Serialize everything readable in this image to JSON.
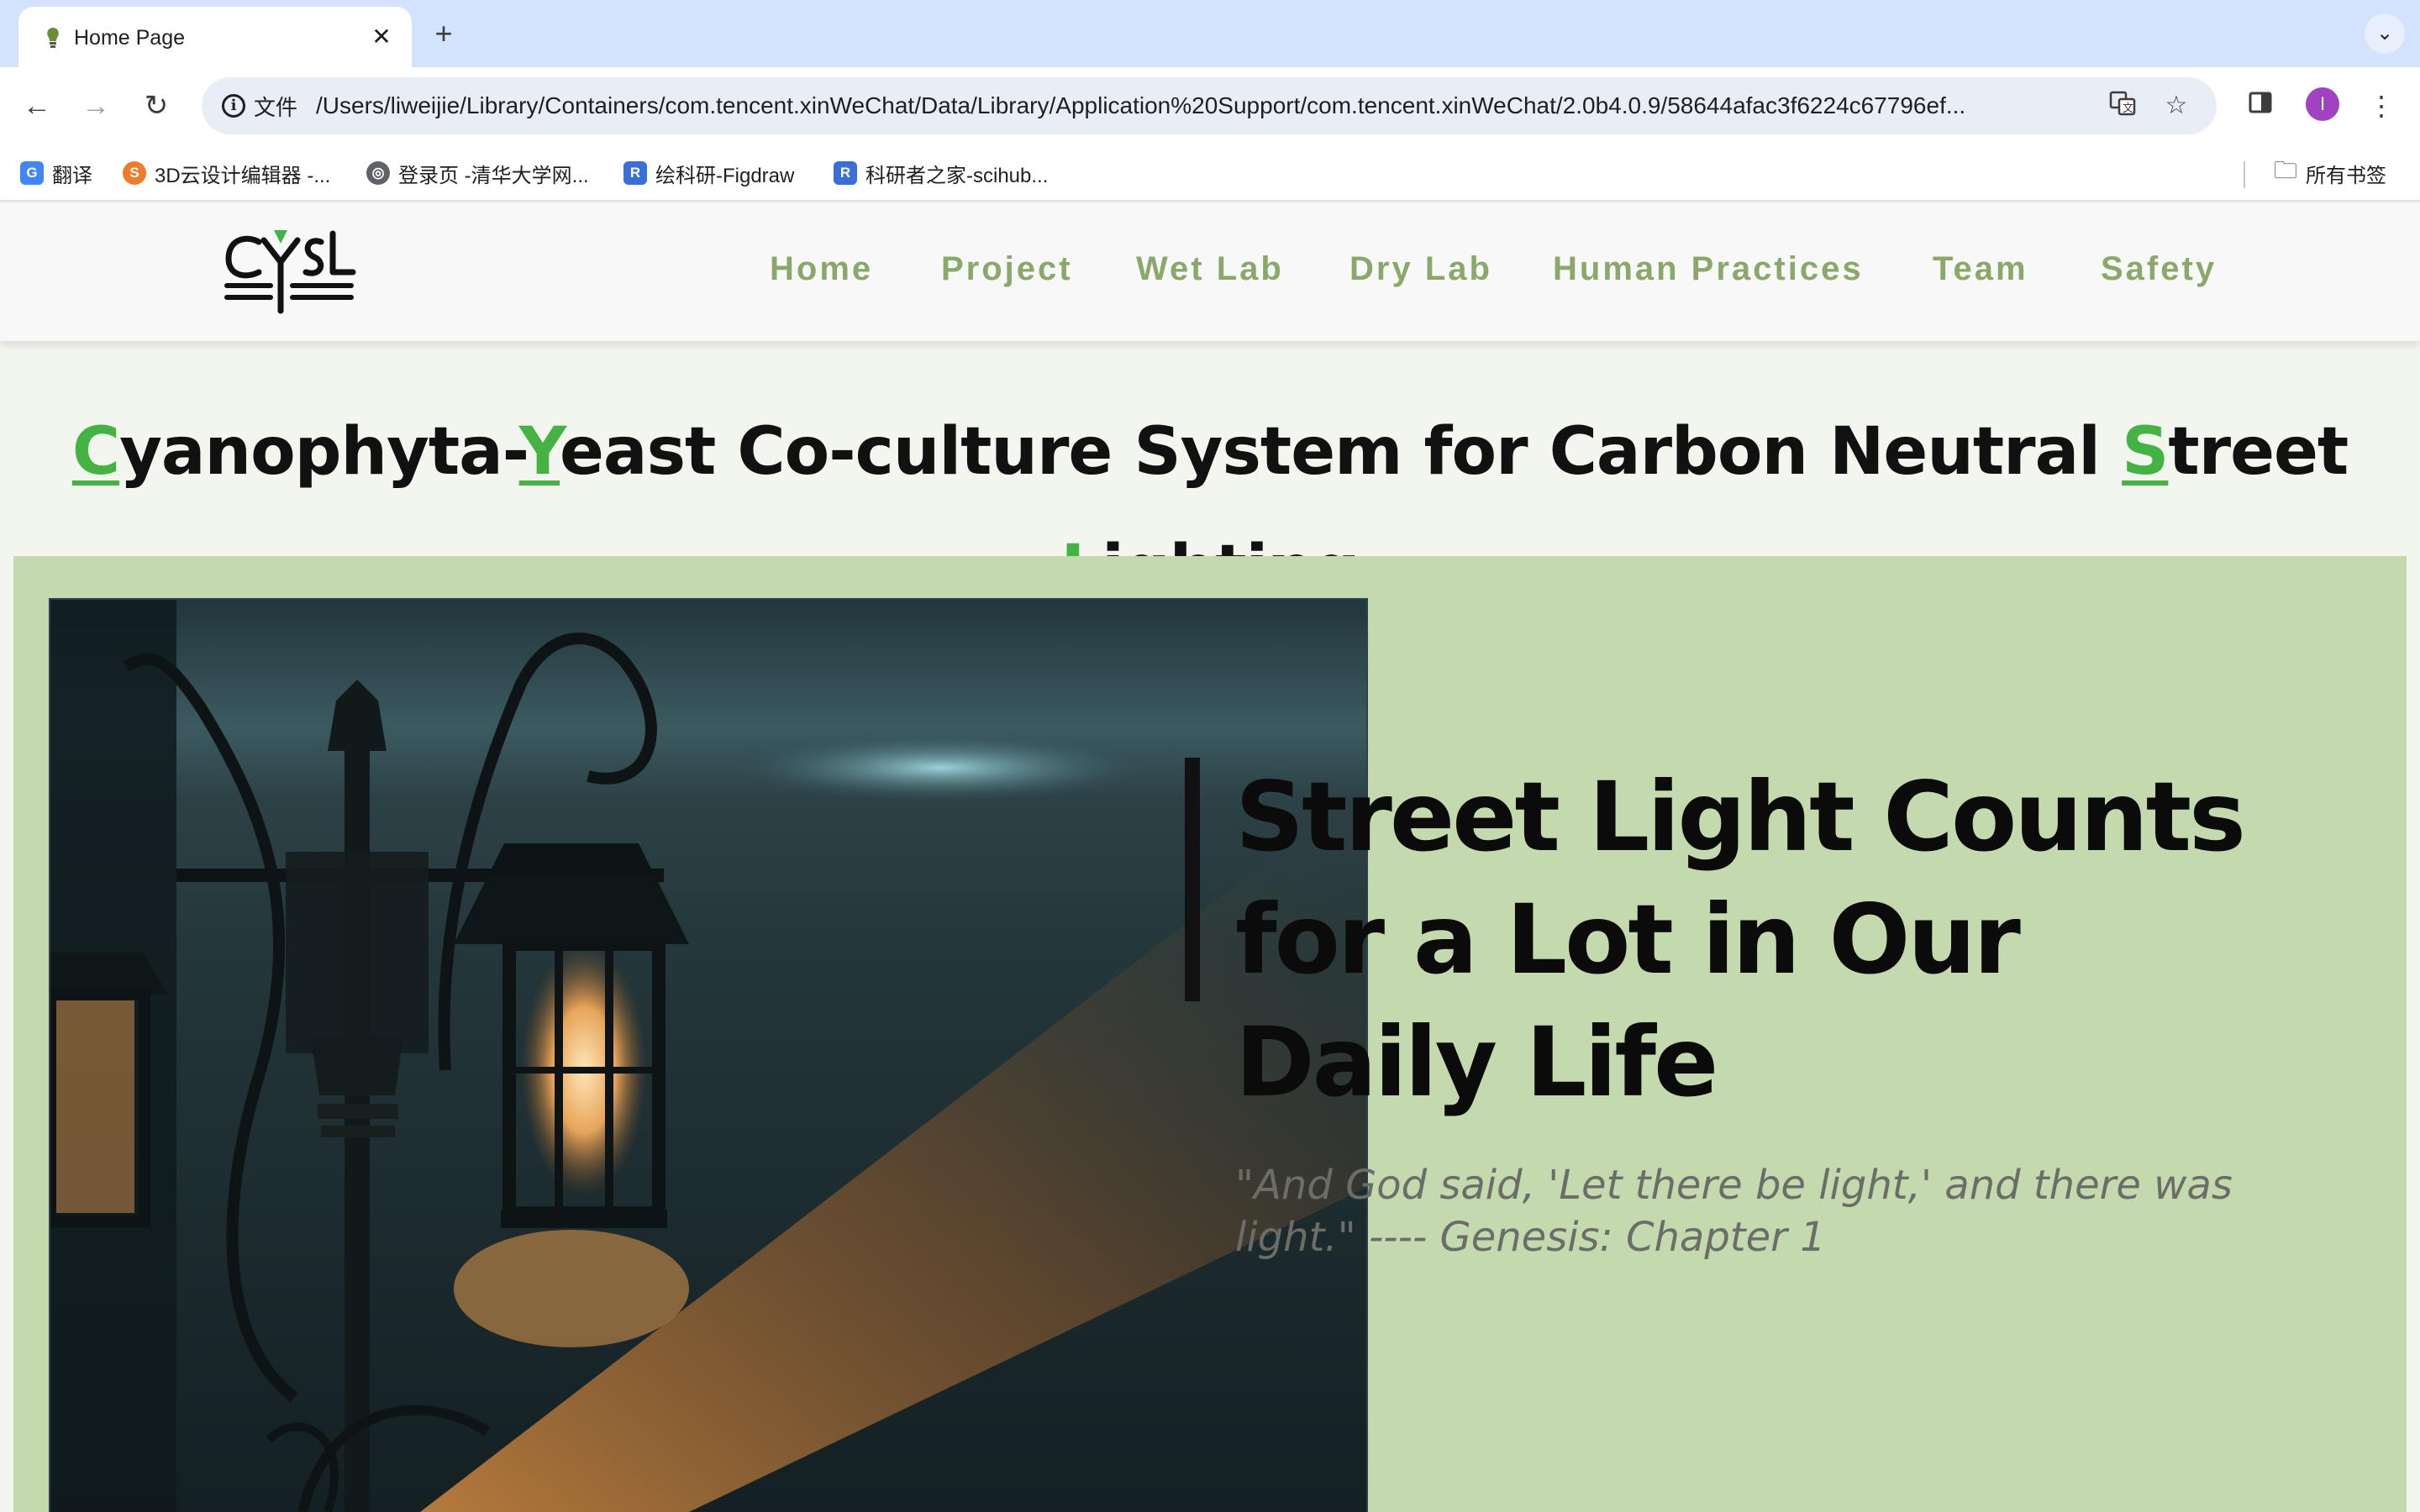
{
  "browser": {
    "tab": {
      "title": "Home Page"
    },
    "new_tab_symbol": "+",
    "address": {
      "security_label": "文件",
      "url": "/Users/liweijie/Library/Containers/com.tencent.xinWeChat/Data/Library/Application%20Support/com.tencent.xinWeChat/2.0b4.0.9/58644afac3f6224c67796ef..."
    },
    "profile_initial": "I",
    "bookmarks": [
      {
        "label": "翻译",
        "icon": "google-translate-icon",
        "color": "#4285f4"
      },
      {
        "label": "3D云设计编辑器 -...",
        "icon": "3d-editor-icon",
        "color": "#f07c2b"
      },
      {
        "label": "登录页 -清华大学网...",
        "icon": "globe-icon",
        "color": "#5f6368"
      },
      {
        "label": "绘科研-Figdraw",
        "icon": "figdraw-icon",
        "color": "#3a6fd8"
      },
      {
        "label": "科研者之家-scihub...",
        "icon": "scihub-icon",
        "color": "#3a6fd8"
      }
    ],
    "all_bookmarks_label": "所有书签"
  },
  "site": {
    "nav": [
      "Home",
      "Project",
      "Wet Lab",
      "Dry Lab",
      "Human Practices",
      "Team",
      "Safety"
    ],
    "logo_alt": "CYSL",
    "title": {
      "line1": [
        {
          "text": "C",
          "hl": true
        },
        {
          "text": "yanophyta-",
          "hl": false
        },
        {
          "text": "Y",
          "hl": true
        },
        {
          "text": "east Co-culture System for Carbon Neutral ",
          "hl": false
        },
        {
          "text": "S",
          "hl": true
        },
        {
          "text": "treet",
          "hl": false
        }
      ],
      "line2": [
        {
          "text": "L",
          "hl": true
        },
        {
          "text": "ighting",
          "hl": false
        }
      ]
    },
    "headline": "Street Light Counts for a Lot in Our Daily Life",
    "quote": "\"And God said, 'Let there be light,' and there was light.\" ---- Genesis: Chapter 1"
  },
  "colors": {
    "accent_green": "#44b344",
    "nav_text": "#8aa86a",
    "panel_bg": "#c5d9ae",
    "page_bg": "#f3f6ee"
  }
}
